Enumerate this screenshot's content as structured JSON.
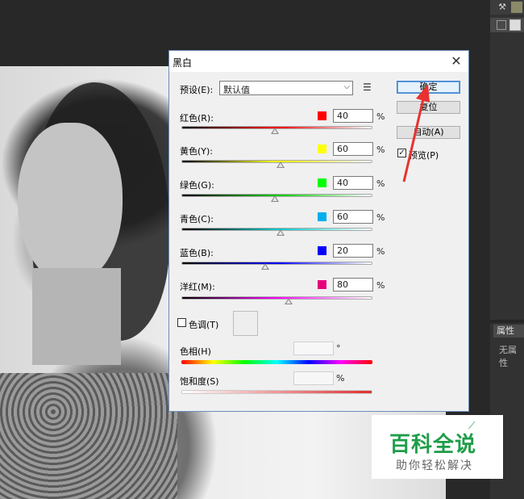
{
  "dialog": {
    "title": "黑白",
    "close_glyph": "✕",
    "preset_label": "预设(E):",
    "preset_value": "默认值",
    "preset_arrow": "⌵",
    "preset_menu_icon": "list-options-icon",
    "buttons": {
      "ok": "确定",
      "reset": "复位",
      "auto": "自动(A)"
    },
    "preview": {
      "label": "预览(P)",
      "checked": true
    },
    "sliders": [
      {
        "label": "红色(R):",
        "color": "#ff0000",
        "value": "40",
        "percent": "%",
        "gradient": [
          "#000000",
          "#ff0000",
          "#ffffff"
        ],
        "position": 0.49
      },
      {
        "label": "黄色(Y):",
        "color": "#ffff00",
        "value": "60",
        "percent": "%",
        "gradient": [
          "#000000",
          "#ffff00",
          "#ffffff"
        ],
        "position": 0.52
      },
      {
        "label": "绿色(G):",
        "color": "#00ff00",
        "value": "40",
        "percent": "%",
        "gradient": [
          "#000000",
          "#00cc00",
          "#ffffff"
        ],
        "position": 0.49
      },
      {
        "label": "青色(C):",
        "color": "#00aeef",
        "value": "60",
        "percent": "%",
        "gradient": [
          "#000000",
          "#00c8c8",
          "#ffffff"
        ],
        "position": 0.52
      },
      {
        "label": "蓝色(B):",
        "color": "#0000ff",
        "value": "20",
        "percent": "%",
        "gradient": [
          "#000000",
          "#0000ff",
          "#ffffff"
        ],
        "position": 0.44
      },
      {
        "label": "洋红(M):",
        "color": "#e6007e",
        "value": "80",
        "percent": "%",
        "gradient": [
          "#000000",
          "#ff00ff",
          "#ffffff"
        ],
        "position": 0.56
      }
    ],
    "tint": {
      "label": "色调(T)",
      "checked": false
    },
    "hue": {
      "label": "色相(H)",
      "unit": "°"
    },
    "saturation": {
      "label": "饱和度(S)",
      "unit": "%"
    }
  },
  "panel": {
    "properties_tab": "属性",
    "properties_text": "无属性"
  },
  "watermark": {
    "title": "百科全说",
    "subtitle": "助你轻松解决"
  },
  "colors": {
    "annotation_arrow": "#e8322f",
    "watermark_green": "#1f9d49",
    "dialog_border": "#6c8eb8"
  }
}
